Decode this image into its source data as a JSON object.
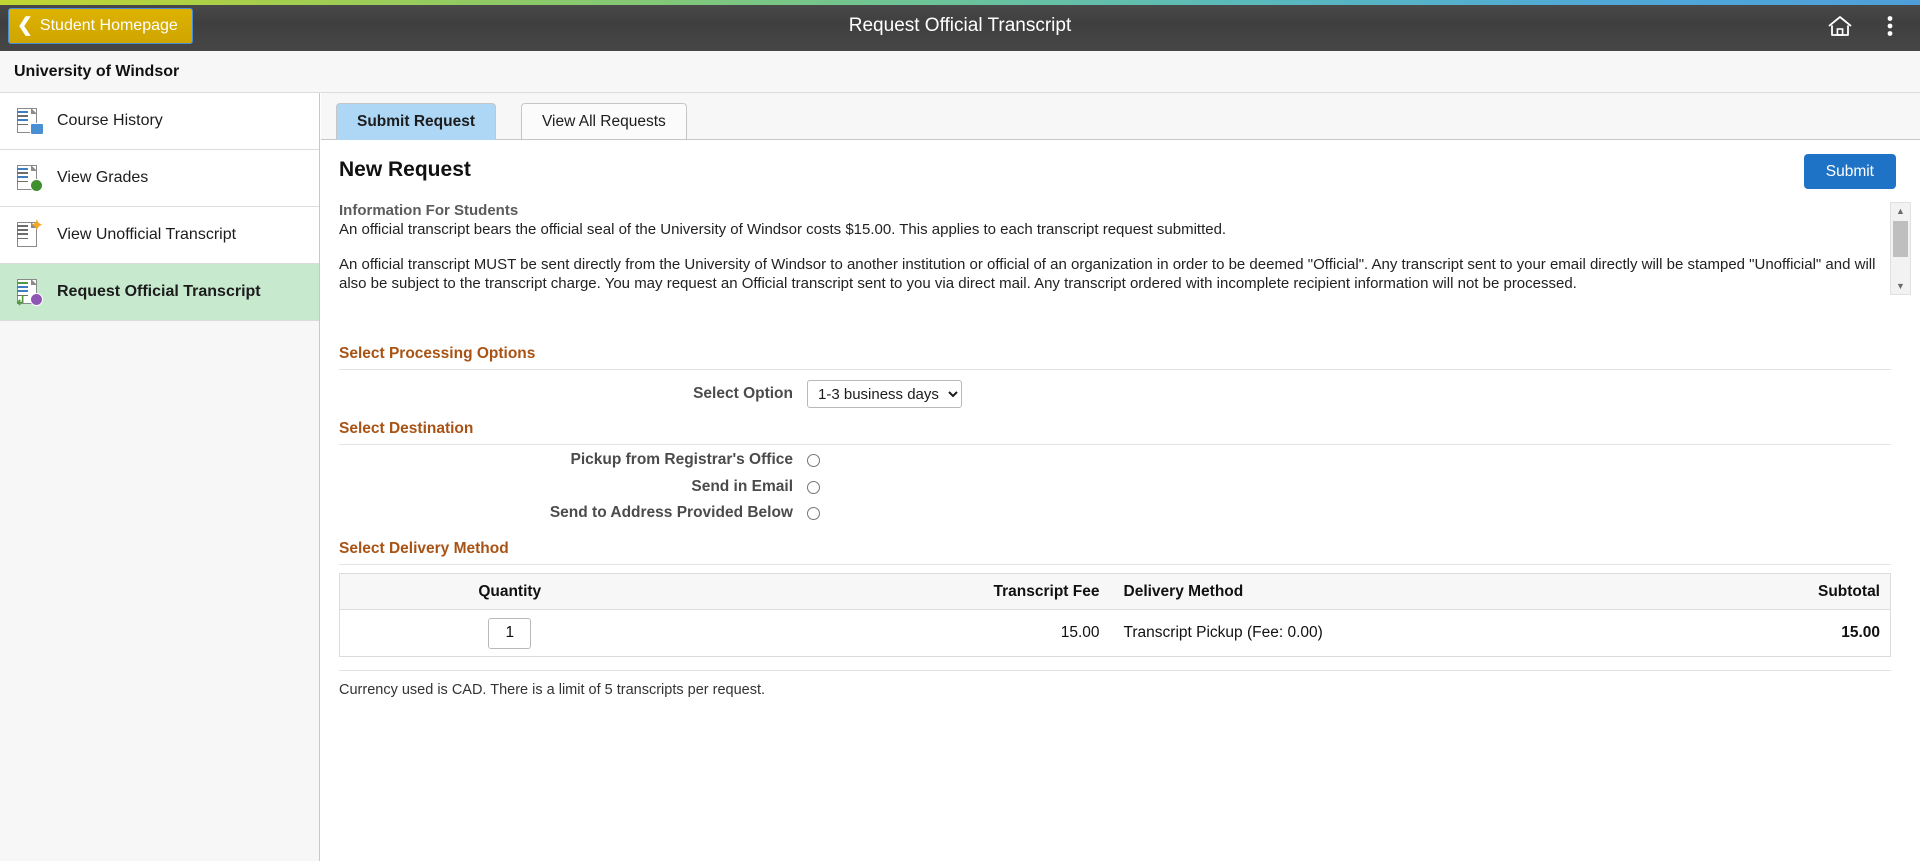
{
  "header": {
    "back_label": "Student Homepage",
    "back_icon": "chevron-left-icon",
    "title": "Request Official Transcript",
    "home_icon": "home-icon",
    "menu_icon": "kebab-menu-icon",
    "accent_color": "#d4ab00",
    "bar_color": "#434343"
  },
  "institution": "University of Windsor",
  "sidebar": {
    "items": [
      {
        "label": "Course History",
        "icon": "course-history-icon",
        "active": false
      },
      {
        "label": "View Grades",
        "icon": "view-grades-icon",
        "active": false
      },
      {
        "label": "View Unofficial Transcript",
        "icon": "unofficial-transcript-icon",
        "active": false
      },
      {
        "label": "Request Official Transcript",
        "icon": "official-transcript-icon",
        "active": true
      }
    ],
    "active_color": "#c7e9ce"
  },
  "tabs": [
    {
      "label": "Submit Request",
      "active": true
    },
    {
      "label": "View All Requests",
      "active": false
    }
  ],
  "main": {
    "page_title": "New Request",
    "submit_label": "Submit",
    "submit_color": "#1f73c6",
    "info": {
      "heading": "Information For Students",
      "paragraph1": "An official transcript bears the official seal of the University of Windsor costs $15.00.  This applies to each transcript request submitted.",
      "paragraph2": "An official transcript MUST be sent directly from the University of Windsor to another institution or official of an organization in order to be deemed \"Official\". Any transcript sent to your email directly will be stamped \"Unofficial\" and will also be subject to the transcript charge. You may request an Official transcript sent to you via direct mail.  Any transcript ordered with incomplete recipient information will not be processed."
    },
    "sections": {
      "processing": "Select Processing Options",
      "destination": "Select Destination",
      "delivery": "Select Delivery Method"
    },
    "processing": {
      "option_label": "Select Option",
      "selected_option": "1-3 business days",
      "options": [
        "1-3 business days"
      ]
    },
    "destination": {
      "options": [
        {
          "label": "Pickup from Registrar's Office",
          "selected": false
        },
        {
          "label": "Send in Email",
          "selected": false
        },
        {
          "label": "Send to Address Provided Below",
          "selected": false
        }
      ]
    },
    "delivery_table": {
      "columns": [
        "Quantity",
        "Transcript Fee",
        "Delivery Method",
        "Subtotal"
      ],
      "rows": [
        {
          "quantity": "1",
          "transcript_fee": "15.00",
          "delivery_method": "Transcript Pickup (Fee: 0.00)",
          "subtotal": "15.00"
        }
      ]
    },
    "footnote": "Currency used is CAD. There is a limit of 5 transcripts per request.",
    "section_heading_color": "#a85314"
  }
}
